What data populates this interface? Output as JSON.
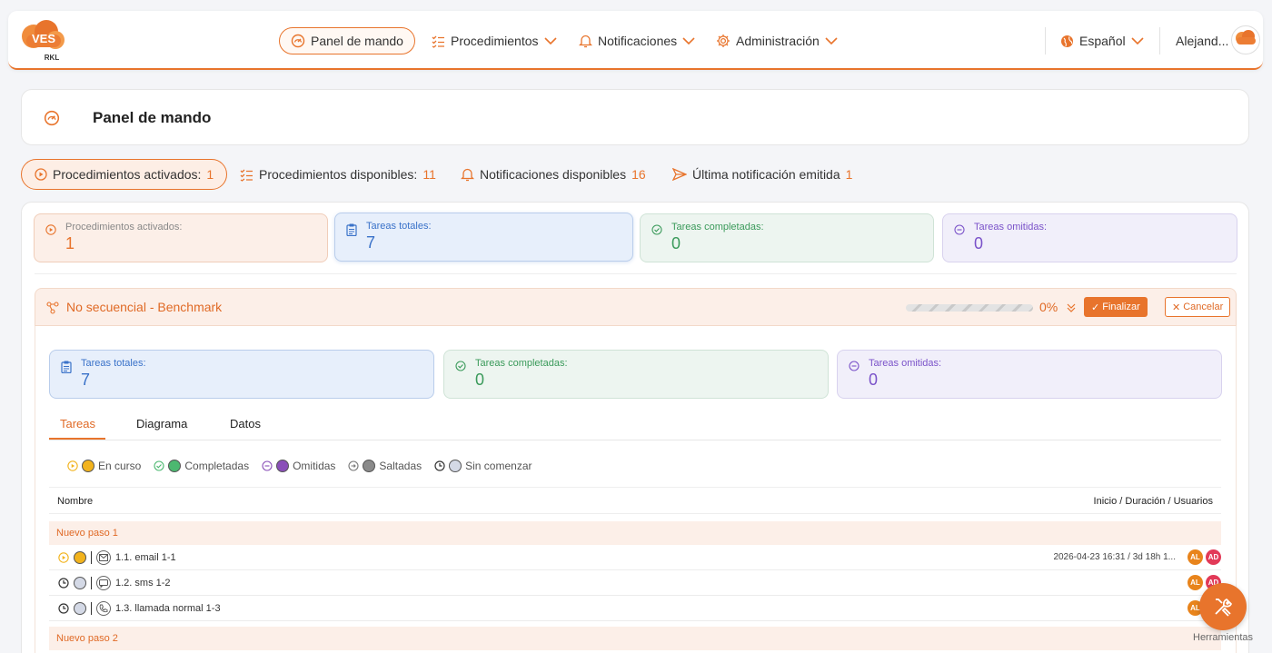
{
  "nav": {
    "items": [
      {
        "label": "Panel de mando",
        "icon": "speedometer-icon"
      },
      {
        "label": "Procedimientos",
        "icon": "checklist-icon"
      },
      {
        "label": "Notificaciones",
        "icon": "bell-icon"
      },
      {
        "label": "Administración",
        "icon": "gear-icon"
      }
    ],
    "language": "Español",
    "user": "Alejand...",
    "logo_text": "VES",
    "logo_sub": "RKL"
  },
  "page": {
    "title": "Panel de mando"
  },
  "summary": [
    {
      "label": "Procedimientos activados:",
      "value": "1"
    },
    {
      "label": "Procedimientos disponibles:",
      "value": "11"
    },
    {
      "label": "Notificaciones disponibles",
      "value": "16"
    },
    {
      "label": "Última notificación emitida",
      "value": "1"
    }
  ],
  "stats_top": [
    {
      "label": "Procedimientos activados:",
      "value": "1"
    },
    {
      "label": "Tareas totales:",
      "value": "7"
    },
    {
      "label": "Tareas completadas:",
      "value": "0"
    },
    {
      "label": "Tareas omitidas:",
      "value": "0"
    }
  ],
  "procedure": {
    "name": "No secuencial - Benchmark",
    "progress_pct": "0%",
    "progress_value": 0,
    "finish_label": "Finalizar",
    "cancel_label": "Cancelar",
    "stats": [
      {
        "label": "Tareas totales:",
        "value": "7"
      },
      {
        "label": "Tareas completadas:",
        "value": "0"
      },
      {
        "label": "Tareas omitidas:",
        "value": "0"
      }
    ],
    "tabs": [
      "Tareas",
      "Diagrama",
      "Datos"
    ],
    "legend": [
      "En curso",
      "Completadas",
      "Omitidas",
      "Saltadas",
      "Sin comenzar"
    ],
    "table": {
      "col_name": "Nombre",
      "col_right": "Inicio / Duración / Usuarios",
      "groups": [
        {
          "label": "Nuevo paso 1",
          "rows": [
            {
              "name": "1.1. email 1-1",
              "date": "2026-04-23 16:31 / 3d 18h 1...",
              "status": "in-progress",
              "channel": "email-icon",
              "users": [
                "AL",
                "AD"
              ]
            },
            {
              "name": "1.2. sms 1-2",
              "date": "",
              "status": "not-started",
              "channel": "sms-icon",
              "users": [
                "AL",
                "AD"
              ]
            },
            {
              "name": "1.3. llamada normal 1-3",
              "date": "",
              "status": "not-started",
              "channel": "phone-icon",
              "users": [
                "AL"
              ]
            }
          ]
        },
        {
          "label": "Nuevo paso 2",
          "rows": []
        }
      ]
    }
  },
  "tools": {
    "label": "Herramientas"
  },
  "colors": {
    "accent": "#e8742c",
    "in_progress": "#f2b31d",
    "completed": "#4cb870",
    "omitted": "#8a4fb8",
    "skipped": "#8a8a8a",
    "not_started": "#d4d9e6"
  }
}
